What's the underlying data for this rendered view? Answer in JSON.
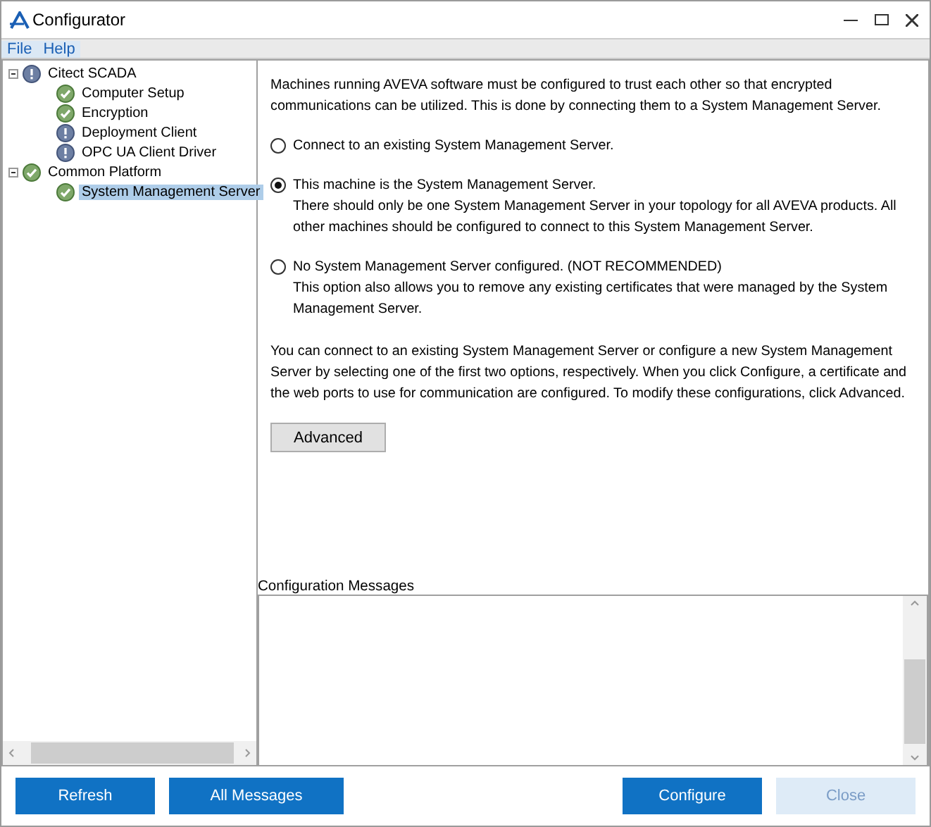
{
  "window": {
    "title": "Configurator"
  },
  "menu": [
    {
      "label": "File"
    },
    {
      "label": "Help"
    }
  ],
  "tree": [
    {
      "label": "Citect SCADA",
      "kind": "info",
      "expanded": true,
      "selected": false,
      "children": [
        {
          "label": "Computer Setup",
          "kind": "ok",
          "selected": false
        },
        {
          "label": "Encryption",
          "kind": "ok",
          "selected": false
        },
        {
          "label": "Deployment Client",
          "kind": "info",
          "selected": false
        },
        {
          "label": "OPC UA Client Driver",
          "kind": "info",
          "selected": false
        }
      ]
    },
    {
      "label": "Common Platform",
      "kind": "ok",
      "expanded": true,
      "selected": false,
      "children": [
        {
          "label": "System Management Server",
          "kind": "ok",
          "selected": true
        }
      ]
    }
  ],
  "intro": "Machines running AVEVA software must be configured to trust each other so that encrypted communications can be utilized. This is done by connecting them to a System Management Server.",
  "options": [
    {
      "label": "Connect to an existing System Management Server.",
      "selected": false
    },
    {
      "label": "This machine is the System Management Server.",
      "description": "There should only be one System Management Server in your topology for all AVEVA products. All other machines should be configured to connect to this System Management Server.",
      "selected": true
    },
    {
      "label": "No System Management Server configured. (NOT RECOMMENDED)",
      "description": "This option also allows you to remove any existing certificates that were managed by the System Management Server.",
      "selected": false
    }
  ],
  "note": "You can connect to an existing System Management Server or configure a new System Management Server by selecting one of the first two options, respectively. When you click Configure, a certificate and the web ports to use for communication are configured. To modify these configurations, click Advanced.",
  "advanced_button": "Advanced",
  "messages": {
    "label": "Configuration Messages"
  },
  "left_buttons": [
    {
      "label": "Refresh",
      "disabled": false
    },
    {
      "label": "All Messages",
      "disabled": false
    }
  ],
  "right_buttons": [
    {
      "label": "Configure",
      "disabled": false
    },
    {
      "label": "Close",
      "disabled": true
    }
  ]
}
